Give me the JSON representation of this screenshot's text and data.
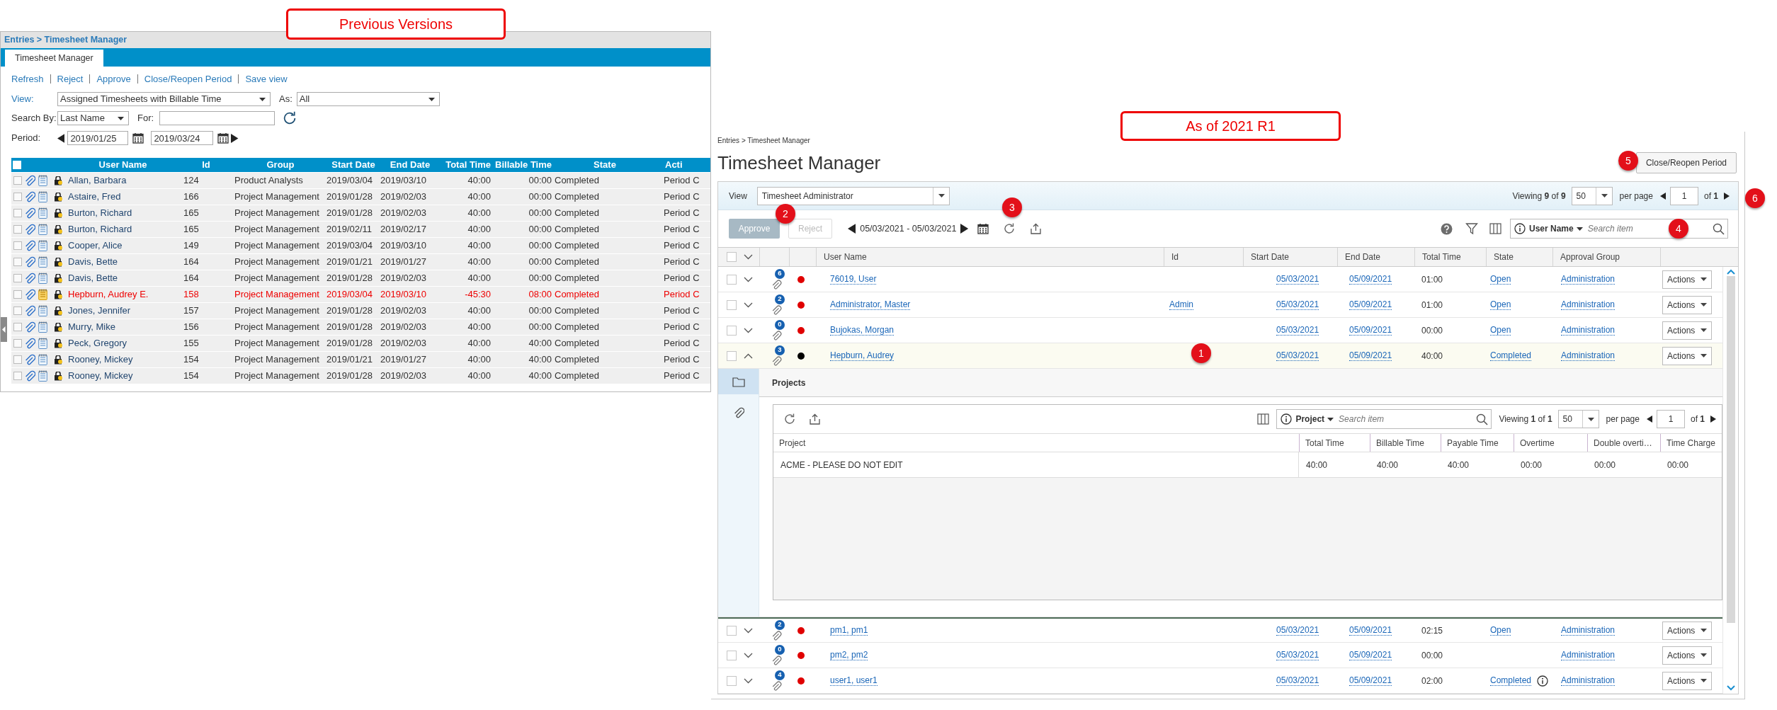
{
  "markers": [
    "1",
    "2",
    "3",
    "4",
    "5",
    "6"
  ],
  "previous": {
    "caption": "Previous Versions",
    "breadcrumb": "Entries > Timesheet Manager",
    "tab": "Timesheet Manager",
    "actions": [
      "Refresh",
      "Reject",
      "Approve",
      "Close/Reopen Period",
      "Save view"
    ],
    "view_label": "View:",
    "view_value": "Assigned Timesheets with Billable Time",
    "as_label": "As:",
    "as_value": "All",
    "search_by_label": "Search By:",
    "search_by_value": "Last Name",
    "for_label": "For:",
    "period_label": "Period:",
    "period_start": "2019/01/25",
    "period_end": "2019/03/24",
    "select_all_checked": false,
    "columns": [
      "User Name",
      "Id",
      "Group",
      "Start Date",
      "End Date",
      "Total Time",
      "Billable Time",
      "State",
      "Acti"
    ],
    "rows": [
      {
        "user": "Allan, Barbara",
        "id": "124",
        "group": "Product Analysts",
        "start": "2019/03/04",
        "end": "2019/03/10",
        "total": "40:00",
        "billable": "00:00",
        "state": "Completed",
        "action": "Period C",
        "flagged": false,
        "checked": false
      },
      {
        "user": "Astaire, Fred",
        "id": "166",
        "group": "Project Management",
        "start": "2019/01/28",
        "end": "2019/02/03",
        "total": "40:00",
        "billable": "00:00",
        "state": "Completed",
        "action": "Period C",
        "flagged": false,
        "checked": false
      },
      {
        "user": "Burton, Richard",
        "id": "165",
        "group": "Project Management",
        "start": "2019/01/28",
        "end": "2019/02/03",
        "total": "40:00",
        "billable": "00:00",
        "state": "Completed",
        "action": "Period C",
        "flagged": false,
        "checked": false
      },
      {
        "user": "Burton, Richard",
        "id": "165",
        "group": "Project Management",
        "start": "2019/02/11",
        "end": "2019/02/17",
        "total": "40:00",
        "billable": "00:00",
        "state": "Completed",
        "action": "Period C",
        "flagged": false,
        "checked": false
      },
      {
        "user": "Cooper, Alice",
        "id": "149",
        "group": "Project Management",
        "start": "2019/03/04",
        "end": "2019/03/10",
        "total": "40:00",
        "billable": "00:00",
        "state": "Completed",
        "action": "Period C",
        "flagged": false,
        "checked": false
      },
      {
        "user": "Davis, Bette",
        "id": "164",
        "group": "Project Management",
        "start": "2019/01/21",
        "end": "2019/01/27",
        "total": "40:00",
        "billable": "00:00",
        "state": "Completed",
        "action": "Period C",
        "flagged": false,
        "checked": false
      },
      {
        "user": "Davis, Bette",
        "id": "164",
        "group": "Project Management",
        "start": "2019/01/28",
        "end": "2019/02/03",
        "total": "40:00",
        "billable": "00:00",
        "state": "Completed",
        "action": "Period C",
        "flagged": false,
        "checked": false
      },
      {
        "user": "Hepburn, Audrey E.",
        "id": "158",
        "group": "Project Management",
        "start": "2019/03/04",
        "end": "2019/03/10",
        "total": "-45:30",
        "billable": "08:00",
        "state": "Completed",
        "action": "Period C",
        "flagged": true,
        "checked": false
      },
      {
        "user": "Jones, Jennifer",
        "id": "157",
        "group": "Project Management",
        "start": "2019/01/28",
        "end": "2019/02/03",
        "total": "40:00",
        "billable": "00:00",
        "state": "Completed",
        "action": "Period C",
        "flagged": false,
        "checked": false
      },
      {
        "user": "Murry, Mike",
        "id": "156",
        "group": "Project Management",
        "start": "2019/01/28",
        "end": "2019/02/03",
        "total": "40:00",
        "billable": "00:00",
        "state": "Completed",
        "action": "Period C",
        "flagged": false,
        "checked": false
      },
      {
        "user": "Peck, Gregory",
        "id": "155",
        "group": "Project Management",
        "start": "2019/01/28",
        "end": "2019/02/03",
        "total": "40:00",
        "billable": "40:00",
        "state": "Completed",
        "action": "Period C",
        "flagged": false,
        "checked": false
      },
      {
        "user": "Rooney, Mickey",
        "id": "154",
        "group": "Project Management",
        "start": "2019/01/21",
        "end": "2019/01/27",
        "total": "40:00",
        "billable": "40:00",
        "state": "Completed",
        "action": "Period C",
        "flagged": false,
        "checked": false
      },
      {
        "user": "Rooney, Mickey",
        "id": "154",
        "group": "Project Management",
        "start": "2019/01/28",
        "end": "2019/02/03",
        "total": "40:00",
        "billable": "40:00",
        "state": "Completed",
        "action": "Period C",
        "flagged": false,
        "checked": false
      }
    ]
  },
  "current": {
    "caption": "As of 2021 R1",
    "breadcrumb": "Entries > Timesheet Manager",
    "title": "Timesheet Manager",
    "close_button": "Close/Reopen Period",
    "view_label": "View",
    "view_value": "Timesheet Administrator",
    "paging": {
      "viewing": "Viewing **9** of **9**",
      "per_page": "50",
      "per_page_label": "per page",
      "page": "1",
      "of": "of **1**"
    },
    "approve": "Approve",
    "reject": "Reject",
    "reject_disabled": true,
    "date_range": "05/03/2021 - 05/03/2021",
    "search": {
      "field": "User Name",
      "placeholder": "Search item"
    },
    "select_all_checked": false,
    "columns": [
      "User Name",
      "Id",
      "Start Date",
      "End Date",
      "Total Time",
      "State",
      "Approval Group"
    ],
    "rows": [
      {
        "user": "76019, User",
        "attachments": "6",
        "color": "#e00000",
        "start": "05/03/2021",
        "end": "05/09/2021",
        "total": "01:00",
        "state": "Open",
        "approval_group": "Administration",
        "actions": "Actions",
        "expanded": false,
        "checked": false
      },
      {
        "user": "Administrator, Master",
        "id": "Admin",
        "attachments": "2",
        "color": "#e00000",
        "start": "05/03/2021",
        "end": "05/09/2021",
        "total": "01:00",
        "state": "Open",
        "approval_group": "Administration",
        "actions": "Actions",
        "expanded": false,
        "checked": false
      },
      {
        "user": "Bujokas, Morgan",
        "attachments": "0",
        "color": "#e00000",
        "start": "05/03/2021",
        "end": "05/09/2021",
        "total": "00:00",
        "state": "Open",
        "approval_group": "Administration",
        "actions": "Actions",
        "expanded": false,
        "checked": false
      },
      {
        "user": "Hepburn, Audrey",
        "attachments": "3",
        "color": "#000000",
        "start": "05/03/2021",
        "end": "05/09/2021",
        "total": "40:00",
        "state": "Completed",
        "approval_group": "Administration",
        "actions": "Actions",
        "expanded": true,
        "checked": false,
        "detail": {
          "tabs": [
            {
              "kind": "folder",
              "selected": true
            },
            {
              "kind": "attachment",
              "selected": false
            }
          ],
          "heading": "Projects",
          "search": {
            "field": "Project",
            "placeholder": "Search item"
          },
          "paging": {
            "viewing": "Viewing **1** of **1**",
            "per_page": "50",
            "per_page_label": "per page",
            "page": "1",
            "of": "of **1**"
          },
          "columns": [
            "Project",
            "Total Time",
            "Billable Time",
            "Payable Time",
            "Overtime",
            "Double overti…",
            "Time Charge"
          ],
          "rows": [
            [
              "ACME - PLEASE DO NOT EDIT",
              "40:00",
              "40:00",
              "40:00",
              "00:00",
              "00:00",
              "00:00"
            ]
          ]
        }
      },
      {
        "user": "pm1, pm1",
        "attachments": "2",
        "color": "#e00000",
        "start": "05/03/2021",
        "end": "05/09/2021",
        "total": "02:15",
        "state": "Open",
        "approval_group": "Administration",
        "actions": "Actions",
        "expanded": false,
        "checked": false
      },
      {
        "user": "pm2, pm2",
        "attachments": "0",
        "color": "#e00000",
        "start": "05/03/2021",
        "end": "05/09/2021",
        "total": "00:00",
        "approval_group": "Administration",
        "actions": "Actions",
        "expanded": false,
        "checked": false
      },
      {
        "user": "user1, user1",
        "attachments": "4",
        "color": "#e00000",
        "start": "05/03/2021",
        "end": "05/09/2021",
        "total": "02:00",
        "state": "Completed",
        "state_info": true,
        "approval_group": "Administration",
        "actions": "Actions",
        "expanded": false,
        "checked": false
      }
    ]
  }
}
